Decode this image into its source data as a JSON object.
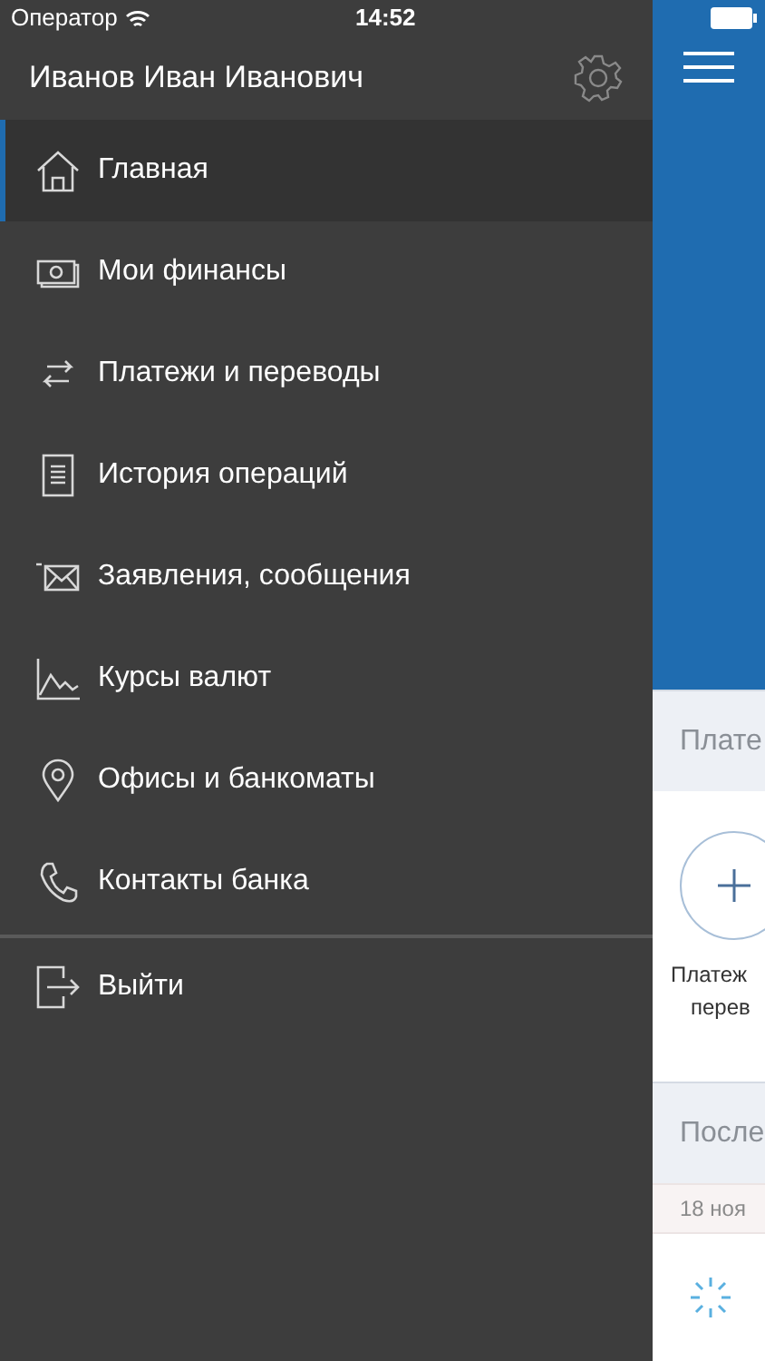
{
  "status_bar": {
    "carrier": "Оператор",
    "time": "14:52"
  },
  "drawer": {
    "user_name": "Иванов Иван Иванович",
    "items": [
      {
        "kind": "home",
        "label": "Главная",
        "selected": true
      },
      {
        "kind": "money",
        "label": "Мои финансы",
        "selected": false
      },
      {
        "kind": "transfer",
        "label": "Платежи и переводы",
        "selected": false
      },
      {
        "kind": "history",
        "label": "История операций",
        "selected": false
      },
      {
        "kind": "mail",
        "label": "Заявления, сообщения",
        "selected": false
      },
      {
        "kind": "chart",
        "label": "Курсы валют",
        "selected": false
      },
      {
        "kind": "pin",
        "label": "Офисы и банкоматы",
        "selected": false
      },
      {
        "kind": "phone",
        "label": "Контакты банка",
        "selected": false
      }
    ],
    "logout": {
      "label": "Выйти"
    }
  },
  "main": {
    "payments_header": "Плате",
    "payment_action": [
      "Платеж",
      "перев"
    ],
    "recent_header": "После",
    "date": "18 ноя"
  }
}
